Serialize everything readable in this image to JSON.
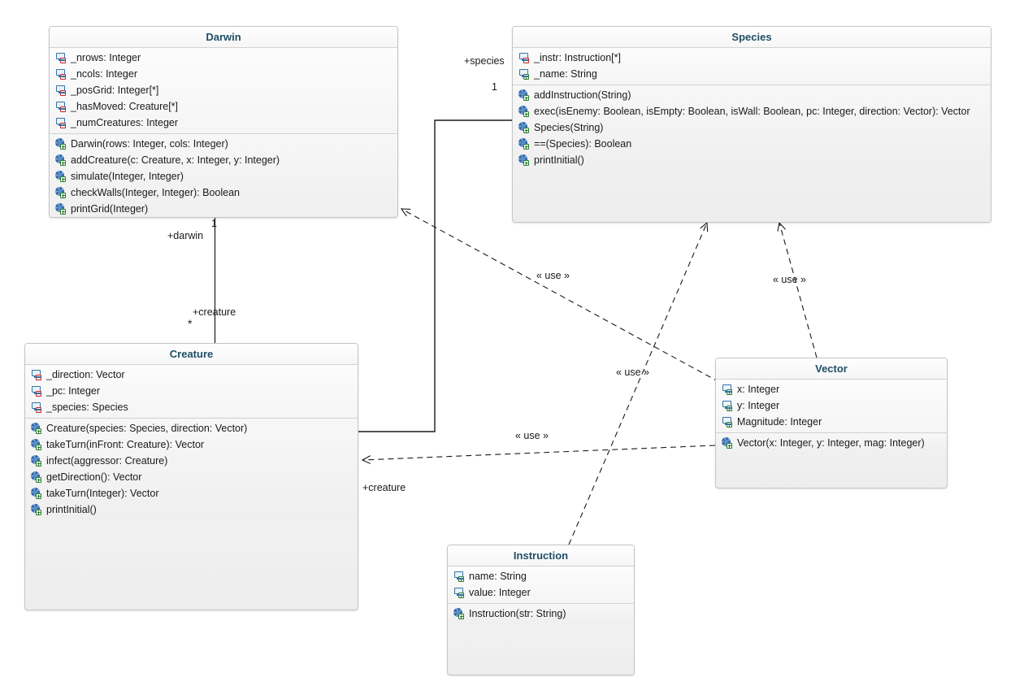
{
  "diagram": {
    "title": "UML Class Diagram",
    "background_color": "#ffffff",
    "class_title_color": "#1f4e66",
    "border_color": "#c6c6c6"
  },
  "classes": {
    "darwin": {
      "name": "Darwin",
      "attributes": [
        {
          "visibility": "private",
          "text": "_nrows: Integer"
        },
        {
          "visibility": "private",
          "text": "_ncols: Integer"
        },
        {
          "visibility": "private",
          "text": "_posGrid: Integer[*]"
        },
        {
          "visibility": "private",
          "text": "_hasMoved: Creature[*]"
        },
        {
          "visibility": "private",
          "text": "_numCreatures: Integer"
        }
      ],
      "methods": [
        {
          "visibility": "public",
          "text": "Darwin(rows: Integer, cols: Integer)"
        },
        {
          "visibility": "public",
          "text": "addCreature(c: Creature, x: Integer, y: Integer)"
        },
        {
          "visibility": "public",
          "text": "simulate(Integer, Integer)"
        },
        {
          "visibility": "public",
          "text": "checkWalls(Integer, Integer): Boolean"
        },
        {
          "visibility": "public",
          "text": "printGrid(Integer)"
        }
      ]
    },
    "species": {
      "name": "Species",
      "attributes": [
        {
          "visibility": "private",
          "text": "_instr: Instruction[*]"
        },
        {
          "visibility": "public",
          "text": "_name: String"
        }
      ],
      "methods": [
        {
          "visibility": "public",
          "text": "addInstruction(String)"
        },
        {
          "visibility": "public",
          "text": "exec(isEnemy: Boolean, isEmpty: Boolean, isWall: Boolean, pc: Integer, direction: Vector): Vector"
        },
        {
          "visibility": "public",
          "text": "Species(String)"
        },
        {
          "visibility": "public",
          "text": "==(Species): Boolean"
        },
        {
          "visibility": "public",
          "text": "printInitial()"
        }
      ]
    },
    "creature": {
      "name": "Creature",
      "attributes": [
        {
          "visibility": "private",
          "text": "_direction: Vector"
        },
        {
          "visibility": "private",
          "text": "_pc: Integer"
        },
        {
          "visibility": "private",
          "text": "_species: Species"
        }
      ],
      "methods": [
        {
          "visibility": "public",
          "text": "Creature(species: Species, direction: Vector)"
        },
        {
          "visibility": "public",
          "text": "takeTurn(inFront: Creature): Vector"
        },
        {
          "visibility": "public",
          "text": "infect(aggressor: Creature)"
        },
        {
          "visibility": "public",
          "text": "getDirection(): Vector"
        },
        {
          "visibility": "public",
          "text": "takeTurn(Integer): Vector"
        },
        {
          "visibility": "public",
          "text": "printInitial()"
        }
      ]
    },
    "vector": {
      "name": "Vector",
      "attributes": [
        {
          "visibility": "public",
          "text": "x: Integer"
        },
        {
          "visibility": "public",
          "text": "y: Integer"
        },
        {
          "visibility": "public",
          "text": "Magnitude: Integer"
        }
      ],
      "methods": [
        {
          "visibility": "public",
          "text": "Vector(x: Integer, y: Integer, mag: Integer)"
        }
      ]
    },
    "instruction": {
      "name": "Instruction",
      "attributes": [
        {
          "visibility": "public",
          "text": "name: String"
        },
        {
          "visibility": "public",
          "text": "value: Integer"
        }
      ],
      "methods": [
        {
          "visibility": "public",
          "text": "Instruction(str: String)"
        }
      ]
    }
  },
  "edge_labels": {
    "species_role": "+species",
    "species_mult": "1",
    "darwin_role": "+darwin",
    "darwin_mult": "1",
    "creature_role_assoc": "+creature",
    "creature_mult": "*",
    "creature_role_dep": "+creature",
    "use_1": "« use »",
    "use_2": "« use »",
    "use_3": "« use »",
    "use_4": "« use »"
  }
}
